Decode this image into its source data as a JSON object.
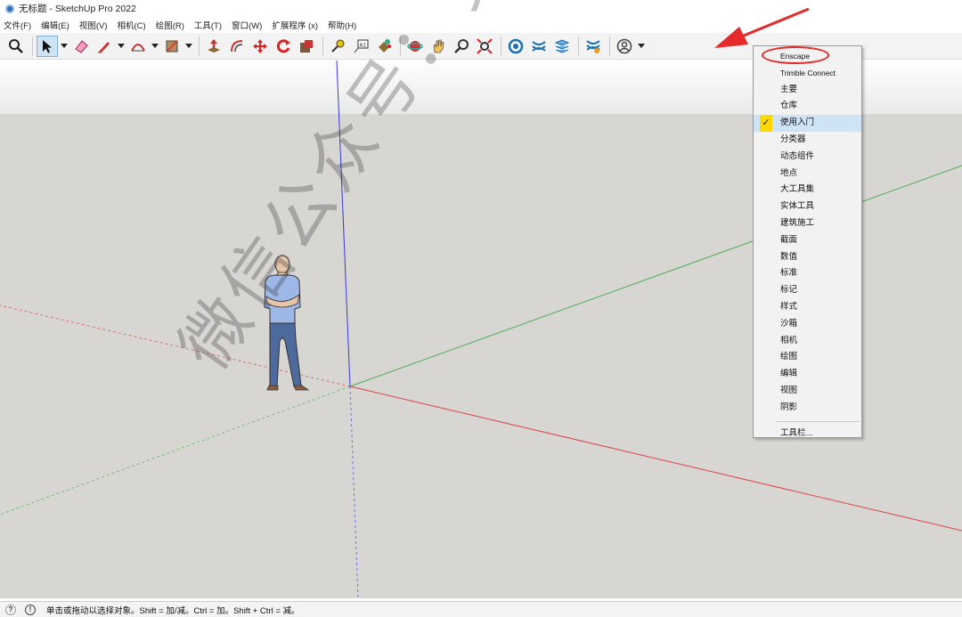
{
  "window": {
    "title": "无标题 - SketchUp Pro 2022"
  },
  "menu": [
    {
      "label": "文件(F)"
    },
    {
      "label": "编辑(E)"
    },
    {
      "label": "视图(V)"
    },
    {
      "label": "相机(C)"
    },
    {
      "label": "绘图(R)"
    },
    {
      "label": "工具(T)"
    },
    {
      "label": "窗口(W)"
    },
    {
      "label": "扩展程序 (x)"
    },
    {
      "label": "帮助(H)"
    }
  ],
  "toolbar_icons": [
    "search-icon",
    "select-icon",
    "eraser-icon",
    "pencil-icon",
    "arc-icon",
    "rectangle-icon",
    "push-pull-icon",
    "offset-icon",
    "move-icon",
    "rotate-icon",
    "scale-icon",
    "tape-measure-icon",
    "text-icon",
    "paint-bucket-icon",
    "orbit-icon",
    "pan-icon",
    "zoom-icon",
    "zoom-extents-icon",
    "warehouse-icon",
    "extension-warehouse-icon",
    "layout-icon",
    "extension-manager-icon",
    "account-icon"
  ],
  "context_menu": {
    "items": [
      {
        "label": "Enscape",
        "checked": false
      },
      {
        "label": "Trimble Connect",
        "checked": false
      },
      {
        "label": "主要",
        "checked": false
      },
      {
        "label": "仓库",
        "checked": false
      },
      {
        "label": "使用入门",
        "checked": true
      },
      {
        "label": "分类器",
        "checked": false
      },
      {
        "label": "动态组件",
        "checked": false
      },
      {
        "label": "地点",
        "checked": false
      },
      {
        "label": "大工具集",
        "checked": false
      },
      {
        "label": "实体工具",
        "checked": false
      },
      {
        "label": "建筑施工",
        "checked": false
      },
      {
        "label": "截面",
        "checked": false
      },
      {
        "label": "数值",
        "checked": false
      },
      {
        "label": "标准",
        "checked": false
      },
      {
        "label": "标记",
        "checked": false
      },
      {
        "label": "样式",
        "checked": false
      },
      {
        "label": "沙箱",
        "checked": false
      },
      {
        "label": "相机",
        "checked": false
      },
      {
        "label": "绘图",
        "checked": false
      },
      {
        "label": "编辑",
        "checked": false
      },
      {
        "label": "视图",
        "checked": false
      },
      {
        "label": "阴影",
        "checked": false
      }
    ],
    "footer": "工具栏...",
    "check_glyph": "✓"
  },
  "watermark": "微信公众号：安装软件指南",
  "status": {
    "icon_label": "!",
    "text": "单击或拖动以选择对象。Shift = 加/减。Ctrl = 加。Shift + Ctrl = 减。"
  },
  "colors": {
    "accent_selected": "#cfe3f7",
    "check_bg": "#ffd800",
    "annotation_red": "#e52a2a",
    "axis_red": "#d44",
    "axis_green": "#4caf50",
    "axis_blue": "#3a3ad0"
  }
}
